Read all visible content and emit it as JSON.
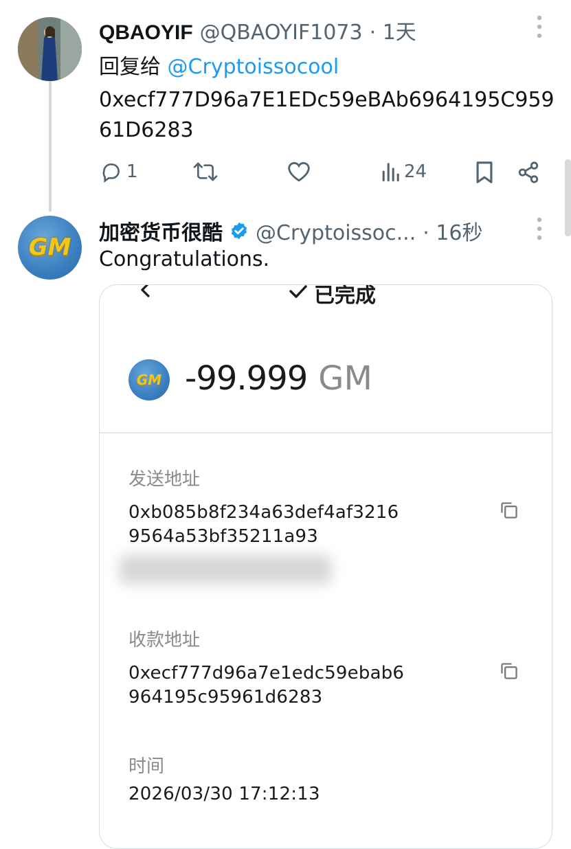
{
  "tweet1": {
    "name": "QBAOYIF",
    "handle": "@QBAOYIF1073",
    "time": "· 1天",
    "reply_prefix": "回复给",
    "reply_to": "@Cryptoissocool",
    "text": "0xecf777D96a7E1EDc59eBAb6964195C95961D6283",
    "actions": {
      "replies": "1",
      "views": "24"
    }
  },
  "tweet2": {
    "name": "加密货币很酷",
    "handle": "@Cryptoissoc...",
    "time": "· 16秒",
    "text": "Congratulations.",
    "avatar_text": "GM"
  },
  "card": {
    "status": "已完成",
    "token_icon_text": "GM",
    "amount": "-99.999",
    "unit": "GM",
    "send_label": "发送地址",
    "send_addr_line1": "0xb085b8f234a63def4af3216",
    "send_addr_line2": "9564a53bf35211a93",
    "recv_label": "收款地址",
    "recv_addr_line1": "0xecf777d96a7e1edc59ebab6",
    "recv_addr_line2": "964195c95961d6283",
    "time_label": "时间",
    "time_value": "2026/03/30 17:12:13"
  },
  "colors": {
    "link": "#1d9bf0",
    "verified": "#1d9bf0",
    "muted": "#536471"
  }
}
